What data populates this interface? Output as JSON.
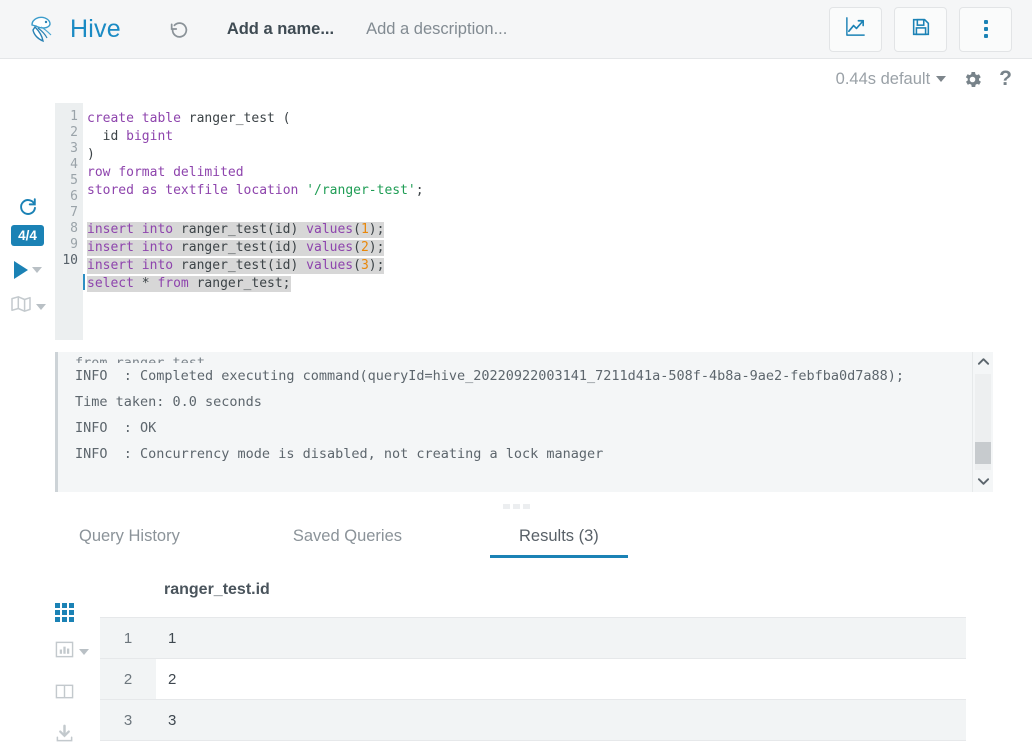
{
  "header": {
    "brand": "Hive",
    "logo_icon": "hive-bee-logo",
    "history_icon": "history-revert-icon",
    "name_placeholder": "Add a name...",
    "description_placeholder": "Add a description...",
    "actions": [
      {
        "label": "visualize",
        "icon": "trending-chart-icon"
      },
      {
        "label": "save",
        "icon": "floppy-save-icon"
      },
      {
        "label": "more",
        "icon": "kebab-menu-icon"
      }
    ],
    "accent_color": "#1b82b5"
  },
  "subbar": {
    "timing_label": "0.44s default",
    "dropdown_icon": "caret-down-icon",
    "settings_icon": "gear-icon",
    "help_icon": "question-mark-icon",
    "help_glyph": "?"
  },
  "editor_rail": {
    "refresh_icon": "refresh-icon",
    "refresh_glyph": "↻",
    "badge": "4/4",
    "run_icon": "play-run-icon",
    "run_caret_icon": "caret-down-icon",
    "map_icon": "visual-explain-map-icon",
    "map_caret_icon": "caret-down-icon"
  },
  "editor": {
    "line_numbers": [
      "1",
      "2",
      "3",
      "4",
      "5",
      "6",
      "7",
      "8",
      "9",
      "10"
    ],
    "active_line": 10,
    "lines": [
      {
        "n": 1,
        "selected": false,
        "tokens": [
          {
            "t": "create",
            "c": "kw"
          },
          {
            "t": " ",
            "c": ""
          },
          {
            "t": "table",
            "c": "kw"
          },
          {
            "t": " ranger_test (",
            "c": ""
          }
        ]
      },
      {
        "n": 2,
        "selected": false,
        "tokens": [
          {
            "t": "  id ",
            "c": ""
          },
          {
            "t": "bigint",
            "c": "kw"
          }
        ]
      },
      {
        "n": 3,
        "selected": false,
        "tokens": [
          {
            "t": ")",
            "c": ""
          }
        ]
      },
      {
        "n": 4,
        "selected": false,
        "tokens": [
          {
            "t": "row",
            "c": "kw"
          },
          {
            "t": " ",
            "c": ""
          },
          {
            "t": "format",
            "c": "kw"
          },
          {
            "t": " ",
            "c": ""
          },
          {
            "t": "delimited",
            "c": "kw"
          }
        ]
      },
      {
        "n": 5,
        "selected": false,
        "tokens": [
          {
            "t": "stored",
            "c": "kw"
          },
          {
            "t": " ",
            "c": ""
          },
          {
            "t": "as",
            "c": "kw"
          },
          {
            "t": " ",
            "c": ""
          },
          {
            "t": "textfile",
            "c": "kw"
          },
          {
            "t": " ",
            "c": ""
          },
          {
            "t": "location",
            "c": "kw"
          },
          {
            "t": " ",
            "c": ""
          },
          {
            "t": "'/ranger-test'",
            "c": "str"
          },
          {
            "t": ";",
            "c": ""
          }
        ]
      },
      {
        "n": 6,
        "selected": false,
        "tokens": [
          {
            "t": "",
            "c": ""
          }
        ]
      },
      {
        "n": 7,
        "selected": true,
        "tokens": [
          {
            "t": "insert",
            "c": "kw"
          },
          {
            "t": " ",
            "c": ""
          },
          {
            "t": "into",
            "c": "kw"
          },
          {
            "t": " ranger_test(id) ",
            "c": ""
          },
          {
            "t": "values",
            "c": "kw"
          },
          {
            "t": "(",
            "c": ""
          },
          {
            "t": "1",
            "c": "num"
          },
          {
            "t": ");",
            "c": ""
          }
        ]
      },
      {
        "n": 8,
        "selected": true,
        "tokens": [
          {
            "t": "insert",
            "c": "kw"
          },
          {
            "t": " ",
            "c": ""
          },
          {
            "t": "into",
            "c": "kw"
          },
          {
            "t": " ranger_test(id) ",
            "c": ""
          },
          {
            "t": "values",
            "c": "kw"
          },
          {
            "t": "(",
            "c": ""
          },
          {
            "t": "2",
            "c": "num"
          },
          {
            "t": ");",
            "c": ""
          }
        ]
      },
      {
        "n": 9,
        "selected": true,
        "tokens": [
          {
            "t": "insert",
            "c": "kw"
          },
          {
            "t": " ",
            "c": ""
          },
          {
            "t": "into",
            "c": "kw"
          },
          {
            "t": " ranger_test(id) ",
            "c": ""
          },
          {
            "t": "values",
            "c": "kw"
          },
          {
            "t": "(",
            "c": ""
          },
          {
            "t": "3",
            "c": "num"
          },
          {
            "t": ");",
            "c": ""
          }
        ]
      },
      {
        "n": 10,
        "selected": true,
        "tokens": [
          {
            "t": "select",
            "c": "kw"
          },
          {
            "t": " * ",
            "c": ""
          },
          {
            "t": "from",
            "c": "kw"
          },
          {
            "t": " ranger_test;",
            "c": ""
          }
        ]
      }
    ],
    "plain_text": "create table ranger_test (\n  id bigint\n)\nrow format delimited\nstored as textfile location '/ranger-test';\n\ninsert into ranger_test(id) values(1);\ninsert into ranger_test(id) values(2);\ninsert into ranger_test(id) values(3);\nselect * from ranger_test;"
  },
  "log": {
    "lines": [
      "from ranger_test",
      "INFO  : Completed executing command(queryId=hive_20220922003141_7211d41a-508f-4b8a-9ae2-febfba0d7a88);",
      "Time taken: 0.0 seconds",
      "INFO  : OK",
      "INFO  : Concurrency mode is disabled, not creating a lock manager"
    ],
    "scroll_up_icon": "chevron-up-icon",
    "scroll_down_icon": "chevron-down-icon",
    "scroll_up_glyph": "∧",
    "scroll_down_glyph": "∨"
  },
  "tabs": [
    {
      "label": "Query History",
      "active": false
    },
    {
      "label": "Saved Queries",
      "active": false
    },
    {
      "label": "Results (3)",
      "active": true
    }
  ],
  "results": {
    "rail": [
      {
        "icon": "grid-view-icon",
        "active": true
      },
      {
        "icon": "chart-view-icon",
        "active": false,
        "caret": "caret-down-icon"
      },
      {
        "icon": "columns-view-icon",
        "active": false
      },
      {
        "icon": "download-icon",
        "active": false
      }
    ],
    "columns": [
      "ranger_test.id"
    ],
    "rows": [
      {
        "num": "1",
        "cells": [
          "1"
        ],
        "hovered": false
      },
      {
        "num": "2",
        "cells": [
          "2"
        ],
        "hovered": true
      },
      {
        "num": "3",
        "cells": [
          "3"
        ],
        "hovered": false
      }
    ]
  },
  "splitters": [
    {
      "name": "editor-log-splitter"
    },
    {
      "name": "log-tabs-splitter"
    }
  ]
}
